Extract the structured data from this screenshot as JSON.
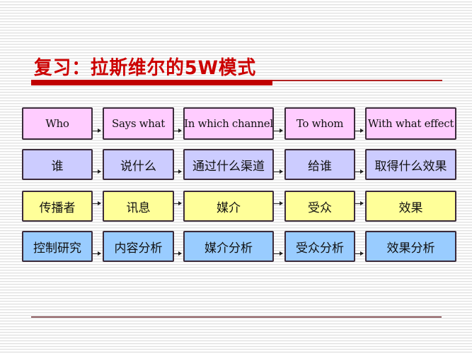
{
  "slide": {
    "title": "复习：拉斯维尔的5W模式",
    "accent_color": "#cc0000"
  },
  "rows": [
    {
      "name": "english",
      "fill": "#ffccff",
      "cells": [
        "Who",
        "Says what",
        "In which channel",
        "To whom",
        "With what effect"
      ]
    },
    {
      "name": "chinese-question",
      "fill": "#ccccff",
      "cells": [
        "谁",
        "说什么",
        "通过什么渠道",
        "给谁",
        "取得什么效果"
      ]
    },
    {
      "name": "element",
      "fill": "#ffff99",
      "cells": [
        "传播者",
        "讯息",
        "媒介",
        "受众",
        "效果"
      ]
    },
    {
      "name": "research-area",
      "fill": "#99ccff",
      "cells": [
        "控制研究",
        "内容分析",
        "媒介分析",
        "受众分析",
        "效果分析"
      ]
    }
  ]
}
